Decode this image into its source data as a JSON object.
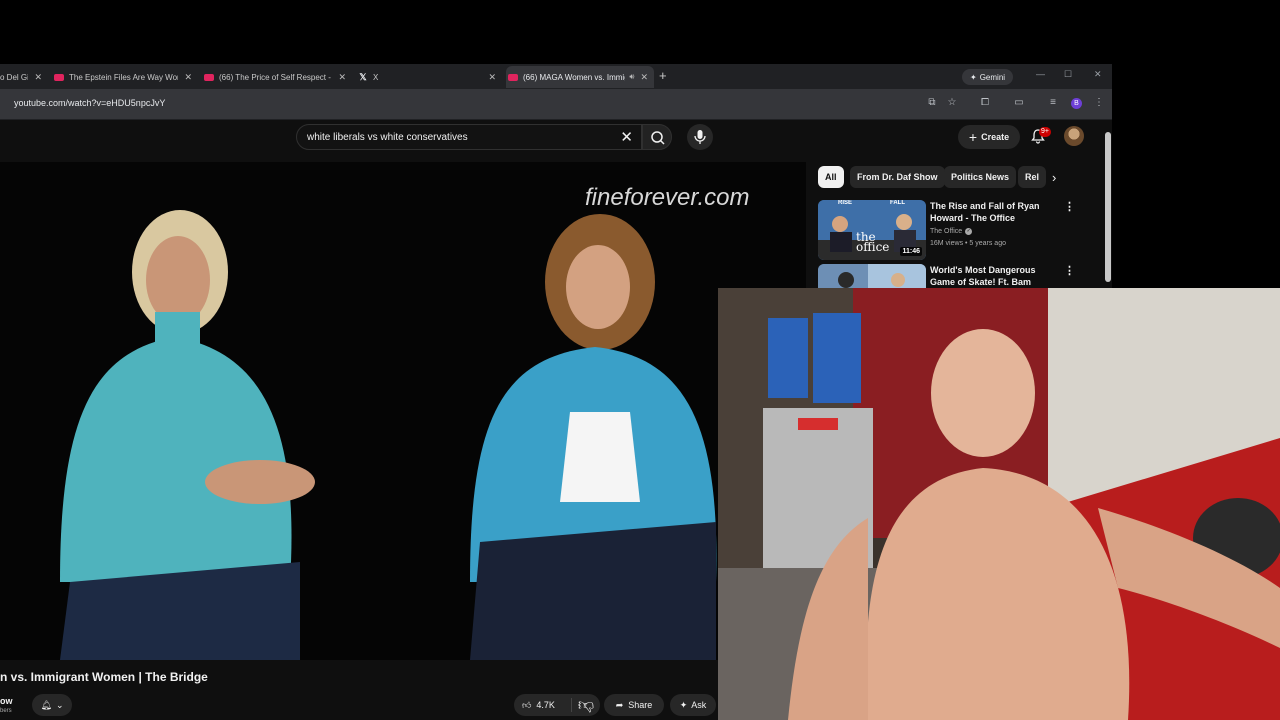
{
  "browser": {
    "tabs": [
      {
        "title": "o Del Gi",
        "active": false
      },
      {
        "title": "The Epstein Files Are Way Worse",
        "active": false
      },
      {
        "title": "(66) The Price of Self Respect -",
        "active": false
      },
      {
        "title": "X",
        "active": false
      },
      {
        "title": "(66) MAGA Women vs. Immigrant",
        "active": true
      }
    ],
    "gemini_label": "Gemini",
    "url": "youtube.com/watch?v=eHDU5npcJvY",
    "profile_initial": "B"
  },
  "youtube": {
    "search_value": "white liberals vs white conservatives",
    "create_label": "Create",
    "notif_badge": "9+",
    "video": {
      "watermark": "fineforever.com",
      "title": "n vs. Immigrant Women | The Bridge",
      "channel_partial": "ow",
      "subs_partial": "bers",
      "likes": "4.7K",
      "share_label": "Share",
      "ask_label": "Ask"
    },
    "chips": [
      {
        "label": "All",
        "active": true
      },
      {
        "label": "From Dr. Daf Show",
        "active": false
      },
      {
        "label": "Politics News",
        "active": false
      },
      {
        "label": "Rel",
        "active": false
      }
    ],
    "recommendations": [
      {
        "title": "The Rise and Fall of Ryan Howard - The Office",
        "channel": "The Office",
        "meta": "16M views • 5 years ago",
        "duration": "11:46",
        "thumb_caption": "the office",
        "thumb_top_left": "RISE",
        "thumb_top_right": "FALL"
      },
      {
        "title": "World's Most Dangerous Game of Skate! Ft. Bam Margera",
        "channel": "",
        "meta": "",
        "duration": ""
      }
    ]
  },
  "colors": {
    "youtube_bg": "#0f0f0f",
    "chrome_bg": "#202124",
    "accent_red": "#cc0000"
  }
}
